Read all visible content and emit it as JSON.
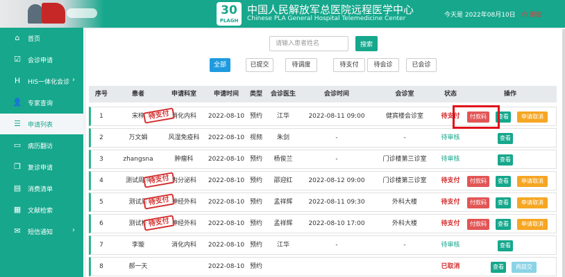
{
  "header": {
    "logo_badge_big": "30",
    "logo_badge_small": "PLAGH",
    "title_cn": "中国人民解放军总医院远程医学中心",
    "title_en": "Chinese PLA General Hospital Telemedicine Center",
    "today": "今天是 2022年08月10日",
    "logout": "退出",
    "logout_icon": "power-icon",
    "brand_color": "#16a78c"
  },
  "sidebar": {
    "items": [
      {
        "label": "首页",
        "icon": "home-icon",
        "glyph": "⌂",
        "chevron": false
      },
      {
        "label": "会诊申请",
        "icon": "checkbox-icon",
        "glyph": "☑",
        "chevron": false
      },
      {
        "label": "HIS一体化会诊",
        "icon": "his-icon",
        "glyph": "H",
        "chevron": true
      },
      {
        "label": "专家查询",
        "icon": "user-icon",
        "glyph": "👤",
        "chevron": false
      },
      {
        "label": "申请列表",
        "icon": "list-icon",
        "glyph": "☰",
        "chevron": false
      },
      {
        "label": "病历翻访",
        "icon": "card-icon",
        "glyph": "▭",
        "chevron": false
      },
      {
        "label": "复诊申请",
        "icon": "copy-icon",
        "glyph": "❐",
        "chevron": false
      },
      {
        "label": "消费清单",
        "icon": "file-icon",
        "glyph": "▤",
        "chevron": false
      },
      {
        "label": "文献检索",
        "icon": "book-icon",
        "glyph": "▦",
        "chevron": false
      },
      {
        "label": "短信通知",
        "icon": "mail-icon",
        "glyph": "✉",
        "chevron": true
      }
    ],
    "active_index": 4
  },
  "search": {
    "placeholder": "请输入患者姓名",
    "button": "搜索"
  },
  "filters": [
    "全部",
    "已提交",
    "待调度",
    "待支付",
    "待会诊",
    "已会诊"
  ],
  "active_filter": "全部",
  "table": {
    "headers": [
      "序号",
      "患者",
      "申请科室",
      "申请时间",
      "类型",
      "会诊医生",
      "会诊时间",
      "会诊室",
      "状态",
      "操作"
    ],
    "rows": [
      {
        "no": "1",
        "patient": "宋梓",
        "dept": "消化内科",
        "date": "2022-08-10",
        "type": "预约",
        "doctor": "江华",
        "time": "2022-08-11 09:00",
        "room": "健宾楼会诊室",
        "status": "待支付",
        "stamp": "待支付",
        "actions": [
          "付款码",
          "查看",
          "申请取消"
        ]
      },
      {
        "no": "2",
        "patient": "万文娟",
        "dept": "风湿免疫科",
        "date": "2022-08-10",
        "type": "视频",
        "doctor": "朱剑",
        "time": "-",
        "room": "-",
        "status": "待审核",
        "stamp": "",
        "actions": [
          "查看"
        ]
      },
      {
        "no": "3",
        "patient": "zhangsna",
        "dept": "肿瘤科",
        "date": "2022-08-10",
        "type": "预约",
        "doctor": "杨俊兰",
        "time": "-",
        "room": "门诊楼第三诊室",
        "status": "待审核",
        "stamp": "",
        "actions": [
          "查看"
        ]
      },
      {
        "no": "4",
        "patient": "测试周末",
        "dept": "内分泌科",
        "date": "2022-08-10",
        "type": "预约",
        "doctor": "邵迎红",
        "time": "2022-08-12 09:00",
        "room": "门诊楼第三诊室",
        "status": "待支付",
        "stamp": "待支付",
        "actions": [
          "付款码",
          "查看",
          "申请取消"
        ]
      },
      {
        "no": "5",
        "patient": "测试周",
        "dept": "神经外科",
        "date": "2022-08-10",
        "type": "预约",
        "doctor": "孟祥辉",
        "time": "2022-08-11 09:30",
        "room": "外科大楼",
        "status": "待支付",
        "stamp": "待支付",
        "actions": [
          "付款码",
          "查看",
          "申请取消"
        ]
      },
      {
        "no": "6",
        "patient": "测试杯",
        "dept": "神经外科",
        "date": "2022-08-10",
        "type": "预约",
        "doctor": "孟祥辉",
        "time": "2022-08-10 17:00",
        "room": "外科大楼",
        "status": "待支付",
        "stamp": "待支付",
        "actions": [
          "付款码",
          "查看",
          "申请取消"
        ]
      },
      {
        "no": "7",
        "patient": "李璇",
        "dept": "消化内科",
        "date": "2022-08-10",
        "type": "预约",
        "doctor": "江华",
        "time": "-",
        "room": "-",
        "status": "待审核",
        "stamp": "",
        "actions": [
          "查看"
        ]
      },
      {
        "no": "8",
        "patient": "郝一天",
        "dept": "",
        "date": "2022-08-10",
        "type": "预约",
        "doctor": "",
        "time": "",
        "room": "",
        "status": "已取消",
        "stamp": "",
        "actions": [
          "查看",
          "再提交"
        ]
      }
    ]
  }
}
